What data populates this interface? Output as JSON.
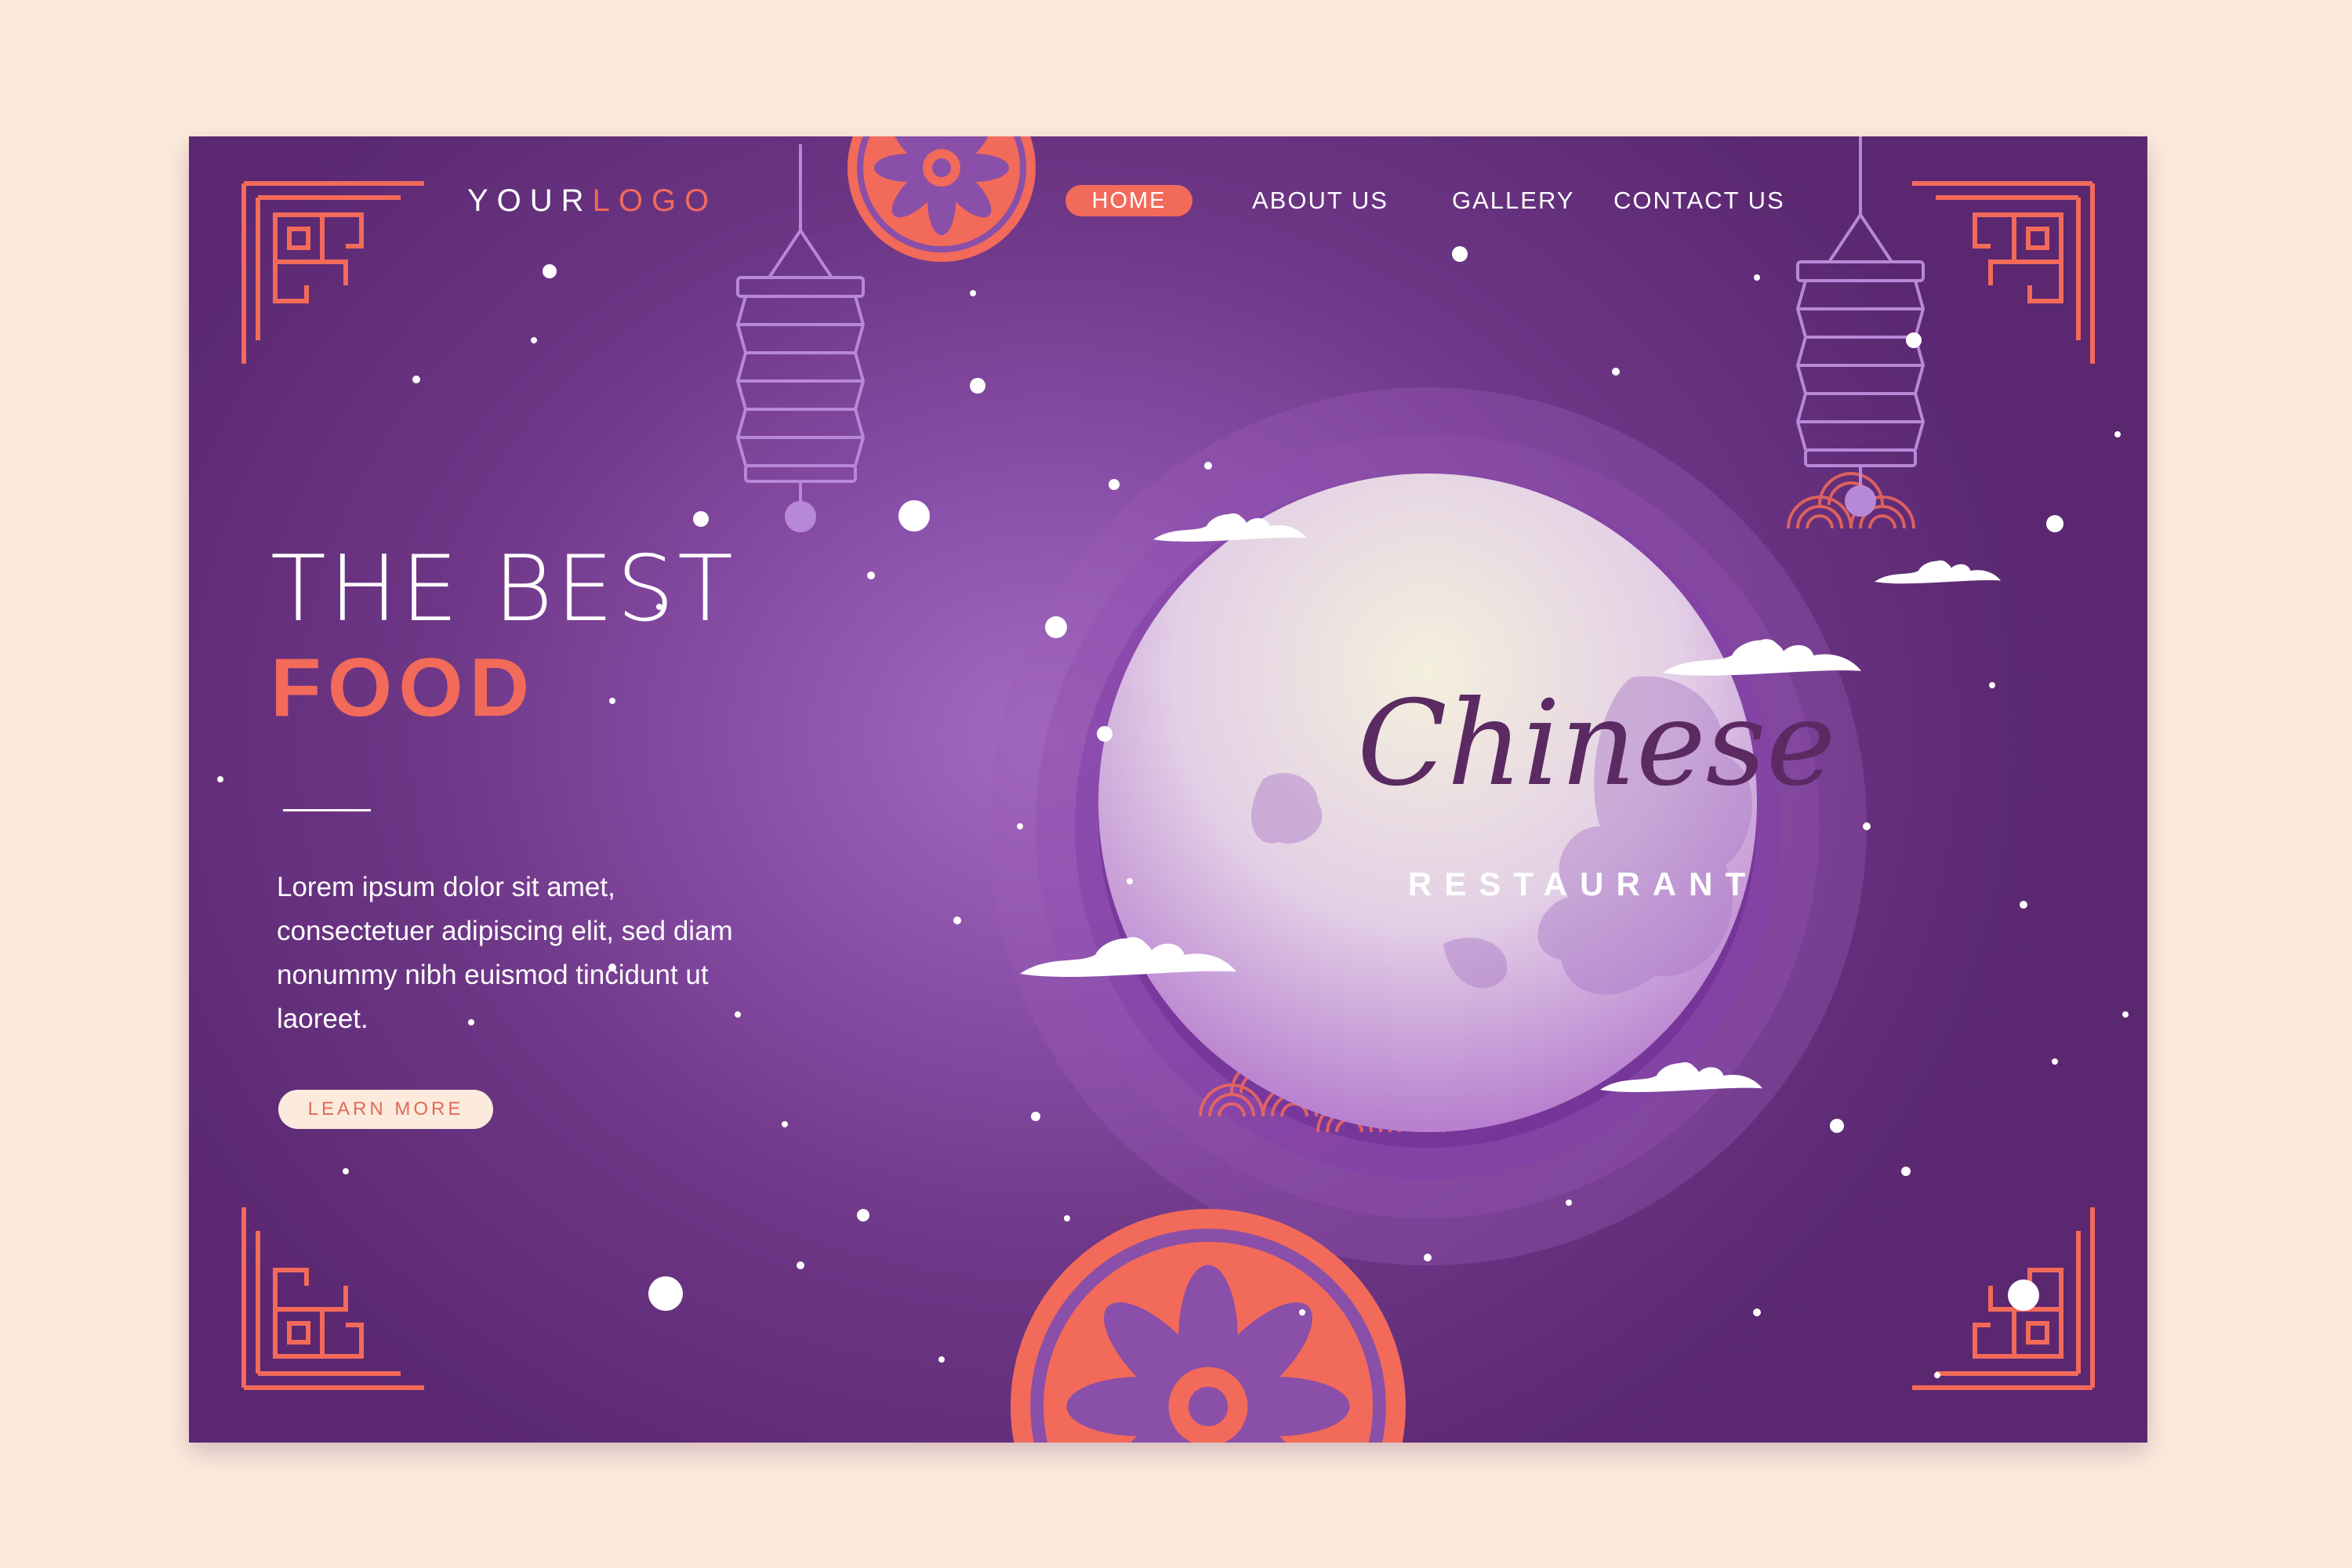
{
  "header": {
    "logo_part1": "YOUR",
    "logo_part2": "LOGO",
    "nav": {
      "home": "HOME",
      "about": "ABOUT US",
      "gallery": "GALLERY",
      "contact": "CONTACT US"
    }
  },
  "hero": {
    "headline_line1": "THE BEST",
    "headline_line2": "FOOD",
    "body": "Lorem ipsum dolor sit amet, consectetuer adipiscing elit, sed diam nonummy nibh euismod tincidunt ut laoreet.",
    "cta": "LEARN MORE"
  },
  "moon": {
    "title": "Chinese",
    "subtitle": "RESTAURANT"
  },
  "colors": {
    "accent": "#f26a5a",
    "background": "#fcebdc",
    "panel": "#7a3f96",
    "moon": "#f3ecf2"
  }
}
